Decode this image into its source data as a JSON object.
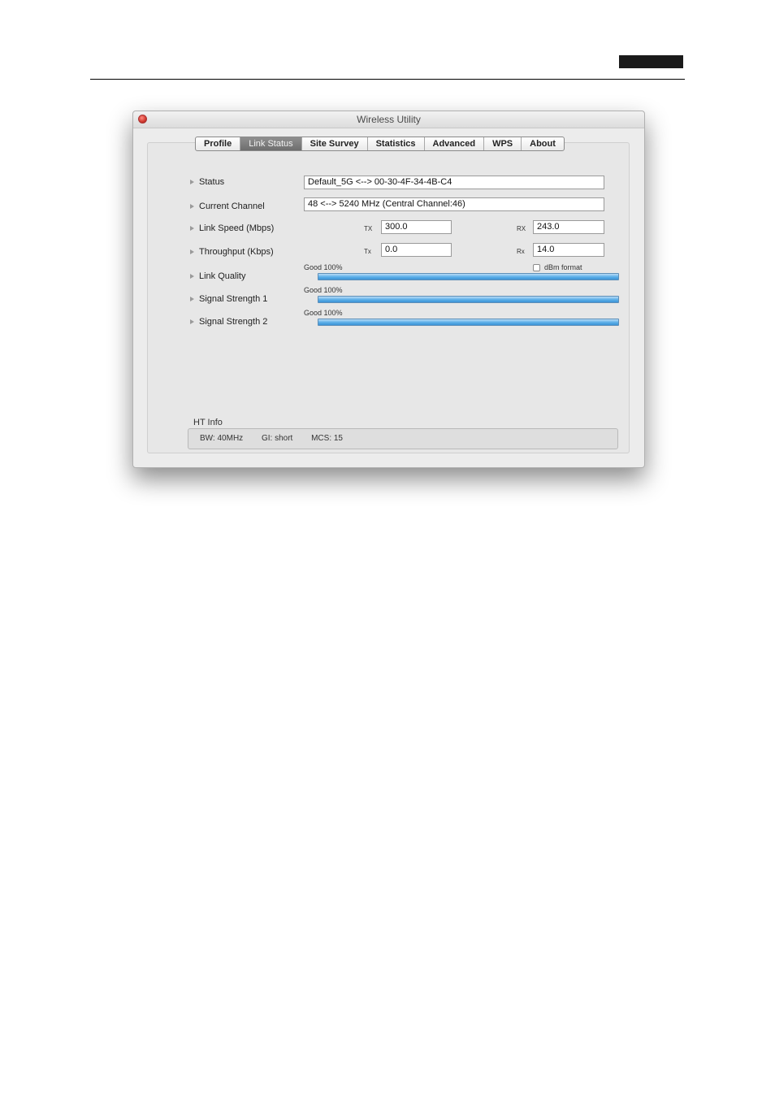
{
  "window": {
    "title": "Wireless Utility"
  },
  "tabs": [
    {
      "label": "Profile"
    },
    {
      "label": "Link Status"
    },
    {
      "label": "Site Survey"
    },
    {
      "label": "Statistics"
    },
    {
      "label": "Advanced"
    },
    {
      "label": "WPS"
    },
    {
      "label": "About"
    }
  ],
  "active_tab": "Link Status",
  "rows": {
    "status": {
      "label": "Status",
      "value": "Default_5G <-->  00-30-4F-34-4B-C4"
    },
    "channel": {
      "label": "Current Channel",
      "value": "48 <--> 5240 MHz (Central Channel:46)"
    },
    "link_speed": {
      "label": "Link Speed (Mbps)",
      "tx_label": "TX",
      "tx_value": "300.0",
      "rx_label": "RX",
      "rx_value": "243.0"
    },
    "throughput": {
      "label": "Throughput (Kbps)",
      "tx_label": "Tx",
      "tx_value": "0.0",
      "rx_label": "Rx",
      "rx_value": "14.0"
    },
    "link_quality": {
      "label": "Link Quality",
      "caption": "Good 100%",
      "percent": 100
    },
    "signal1": {
      "label": "Signal Strength 1",
      "caption": "Good 100%",
      "percent": 100
    },
    "signal2": {
      "label": "Signal Strength 2",
      "caption": "Good 100%",
      "percent": 100
    }
  },
  "dbm_format": {
    "label": "dBm format",
    "checked": false
  },
  "ht_info": {
    "title": "HT Info",
    "bw": "BW: 40MHz",
    "gi": "GI: short",
    "mcs": "MCS: 15"
  },
  "colors": {
    "bar_fill": "#5aaee8",
    "active_tab": "#7e7e7e",
    "close_button": "#d0382e"
  }
}
